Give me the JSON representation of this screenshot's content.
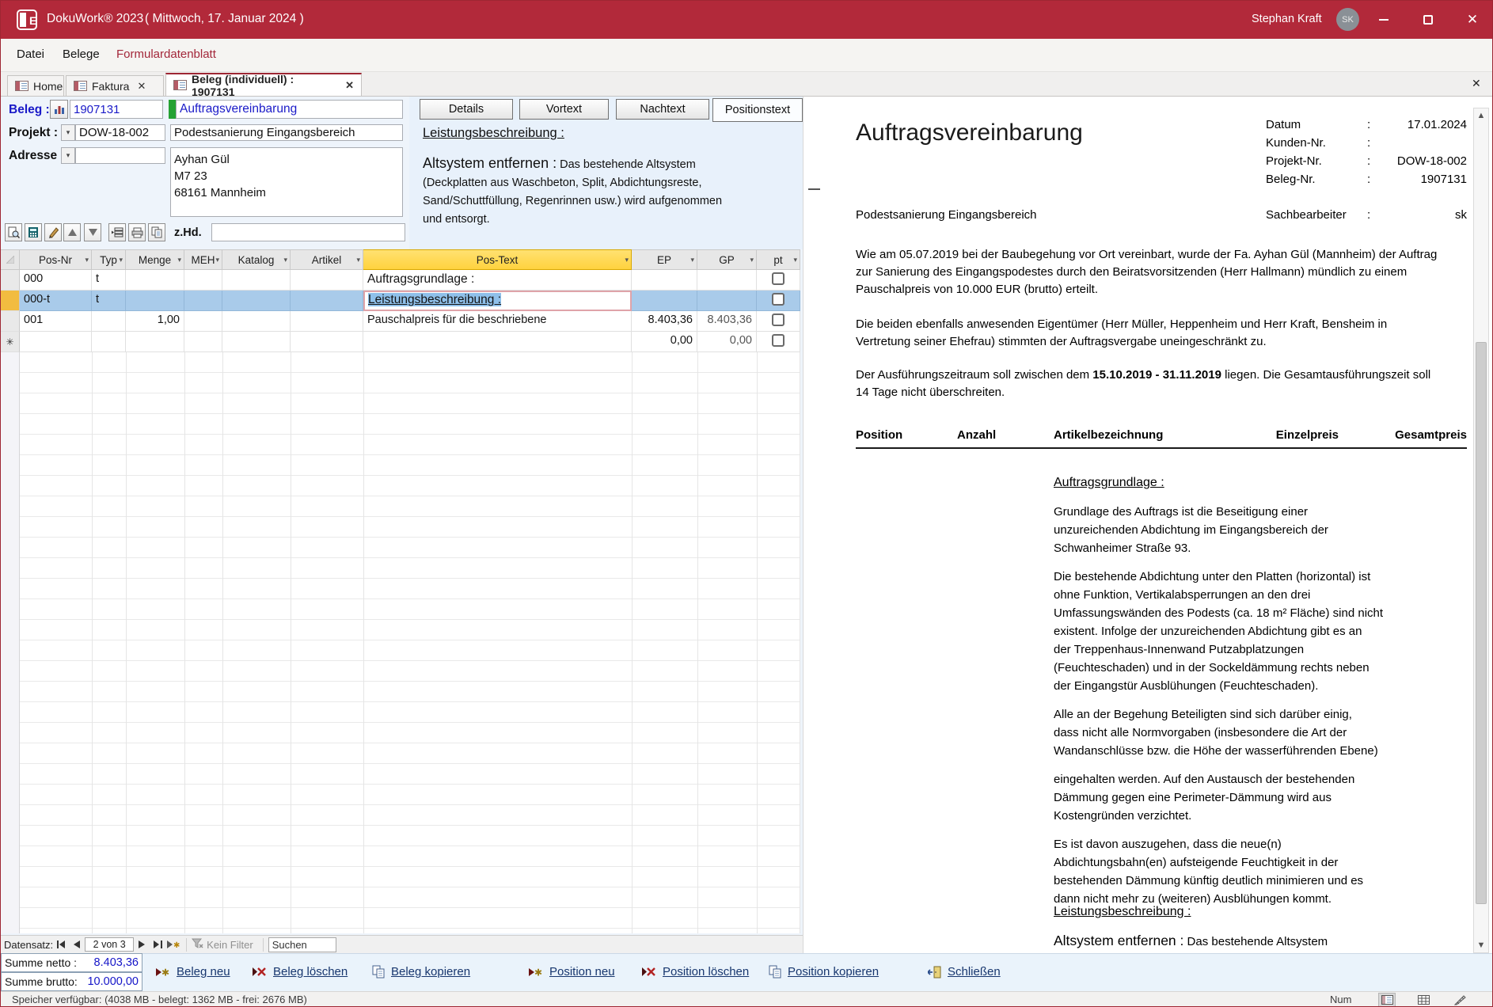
{
  "colors": {
    "titlebar_red": "#B2293A",
    "accent_red": "#9E2633",
    "selection_blue": "#A9CBEA",
    "postext_header_yellow": "#FFD23E",
    "link_navy": "#17366E",
    "value_blue": "#1414C8",
    "green_indicator": "#25A233",
    "toolbar_blue_bg": "#EAF3FB"
  },
  "window": {
    "app_title": "DokuWork® 2023",
    "date_suffix": "( Mittwoch, 17. Januar 2024 )",
    "user": "Stephan Kraft",
    "user_initials": "SK"
  },
  "menu": {
    "items": [
      "Datei",
      "Belege",
      "Formulardatenblatt"
    ]
  },
  "tabs": [
    {
      "label": "Home"
    },
    {
      "label": "Faktura",
      "close": "✕"
    },
    {
      "label": "Beleg (individuell) : 1907131",
      "close": "✕"
    }
  ],
  "tabstrip_close": "✕",
  "form": {
    "beleg_label": "Beleg :",
    "beleg_nr": "1907131",
    "beleg_name": "Auftragsvereinbarung",
    "projekt_label": "Projekt :",
    "projekt_nr": "DOW-18-002",
    "projekt_name": "Podestsanierung Eingangsbereich",
    "adresse_label": "Adresse :",
    "adresse_value": "",
    "adresse_text": "Ayhan Gül\nM7 23\n68161 Mannheim",
    "zhd_label": "z.Hd.",
    "zhd_value": ""
  },
  "text_tabs": {
    "buttons": [
      "Details",
      "Vortext",
      "Nachtext",
      "Positionstext"
    ]
  },
  "text_panel": {
    "heading": "Leistungsbeschreibung :",
    "lead": "Altsystem entfernen :",
    "body": " Das bestehende Altsystem\n(Deckplatten aus Waschbeton, Split, Abdichtungsreste,\nSand/Schuttfüllung, Regenrinnen usw.) wird aufgenommen\nund entsorgt."
  },
  "grid": {
    "columns": [
      "Pos-Nr",
      "Typ",
      "Menge",
      "MEH",
      "Katalog",
      "Artikel",
      "Pos-Text",
      "EP",
      "GP",
      "pt"
    ],
    "rows": [
      {
        "pos": "000",
        "typ": "t",
        "menge": "",
        "pos_text": "Auftragsgrundlage :",
        "ep": "",
        "gp": ""
      },
      {
        "pos": "000-t",
        "typ": "t",
        "menge": "",
        "pos_text": "Leistungsbeschreibung :",
        "ep": "",
        "gp": ""
      },
      {
        "pos": "001",
        "typ": "",
        "menge": "1,00",
        "pos_text": "Pauschalpreis für die beschriebene",
        "ep": "8.403,36",
        "gp": "8.403,36"
      },
      {
        "pos": "✳",
        "typ": "",
        "menge": "",
        "pos_text": "",
        "ep": "0,00",
        "gp": "0,00"
      }
    ]
  },
  "record_nav": {
    "label": "Datensatz:",
    "position": "2 von 3",
    "filter": "Kein Filter",
    "search": "Suchen"
  },
  "totals": {
    "netto_label": "Summe netto :",
    "netto": "8.403,36",
    "brutto_label": "Summe brutto:",
    "brutto": "10.000,00"
  },
  "actions": [
    "Beleg neu",
    "Beleg löschen",
    "Beleg kopieren",
    "Position neu",
    "Position löschen",
    "Position kopieren",
    "Schließen"
  ],
  "status": {
    "memory": "Speicher verfügbar: (4038 MB - belegt: 1362 MB - frei: 2676 MB)",
    "num": "Num"
  },
  "document": {
    "title": "Auftragsvereinbarung",
    "colon": ":",
    "meta": [
      {
        "label": "Datum",
        "value": "17.01.2024"
      },
      {
        "label": "Kunden-Nr.",
        "value": ""
      },
      {
        "label": "Projekt-Nr.",
        "value": "DOW-18-002"
      },
      {
        "label": "Beleg-Nr.",
        "value": "1907131"
      }
    ],
    "subject": "Podestsanierung Eingangsbereich",
    "clerk_label": "Sachbearbeiter",
    "clerk": "sk",
    "p1": "Wie am 05.07.2019 bei der Baubegehung vor Ort vereinbart, wurde der Fa. Ayhan Gül (Mannheim) der Auftrag\nzur Sanierung des Eingangspodestes durch den Beiratsvorsitzenden (Herr Hallmann) mündlich zu einem\nPauschalpreis von 10.000 EUR (brutto) erteilt.",
    "p2": "Die beiden ebenfalls anwesenden Eigentümer (Herr Müller, Heppenheim und Herr Kraft, Bensheim in\nVertretung seiner Ehefrau) stimmten der Auftragsvergabe uneingeschränkt zu.",
    "p3_before": "Der Ausführungszeitraum soll zwischen dem ",
    "p3_bold": "15.10.2019 - 31.11.2019",
    "p3_after": " liegen. Die Gesamtausführungszeit soll\n14 Tage nicht überschreiten.",
    "table_header": [
      "Position",
      "Anzahl",
      "Artikelbezeichnung",
      "Einzelpreis",
      "Gesamtpreis"
    ],
    "section1_heading": "Auftragsgrundlage :",
    "s1p1": "Grundlage des Auftrags ist die Beseitigung einer\nunzureichenden Abdichtung im Eingangsbereich der\nSchwanheimer Straße 93.",
    "s1p2": "Die bestehende Abdichtung unter den Platten (horizontal) ist\nohne Funktion, Vertikalabsperrungen an den drei\nUmfassungswänden des Podests (ca. 18 m² Fläche) sind nicht\nexistent. Infolge der unzureichenden Abdichtung gibt es an\nder Treppenhaus-Innenwand Putzabplatzungen\n(Feuchteschaden) und in der Sockeldämmung rechts neben\nder Eingangstür Ausblühungen (Feuchteschaden).",
    "s1p3": "Alle an der Begehung Beteiligten sind sich darüber einig,\ndass nicht alle Normvorgaben (insbesondere die Art der\nWandanschlüsse bzw. die Höhe der wasserführenden Ebene)",
    "s1p4": "eingehalten werden. Auf den Austausch der bestehenden\nDämmung gegen eine Perimeter-Dämmung wird aus\nKostengründen verzichtet.",
    "s1p5": "Es ist davon auszugehen, dass die neue(n)\nAbdichtungsbahn(en) aufsteigende Feuchtigkeit in der\nbestehenden Dämmung künftig deutlich minimieren und es\ndann nicht mehr zu (weiteren) Ausblühungen kommt.",
    "section2_heading": "Leistungsbeschreibung :",
    "section2_lead": "Altsystem entfernen :",
    "section2_body": " Das bestehende Altsystem\n(Deckplatten aus Waschbeton, Split, Abdichtungsreste"
  }
}
